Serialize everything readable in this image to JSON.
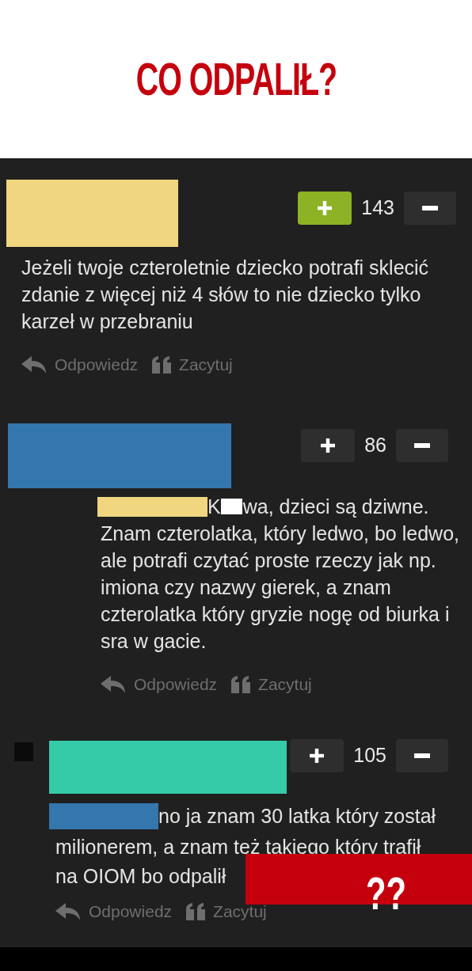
{
  "headline": "CO ODPALIŁ?",
  "comments": [
    {
      "color": "#f0d67f",
      "votes": {
        "upvoted": true,
        "score": "143"
      },
      "text": "Jeżeli twoje czteroletnie dziecko potrafi sklecić zdanie z więcej niż 4 słów to nie dziecko tylko karzeł w przebraniu",
      "actions": [
        "Odpowiedz",
        "Zacytuj"
      ]
    },
    {
      "color": "#3476ae",
      "votes": {
        "upvoted": false,
        "score": "86"
      },
      "reply_to": {
        "color": "#f0d67f"
      },
      "lead": "K",
      "censor": true,
      "first_line": "wa, dzieci są dziwne.",
      "text": "Znam czterolatka, który ledwo, bo ledwo, ale potrafi czytać proste rzeczy jak np. imiona czy nazwy gierek, a znam czterolatka który gryzie nogę od biurka i sra w gacie.",
      "actions": [
        "Odpowiedz",
        "Zacytuj"
      ]
    },
    {
      "color": "#35cba8",
      "avatar": true,
      "votes": {
        "upvoted": false,
        "score": "105"
      },
      "reply_to": {
        "color": "#3476ae"
      },
      "first_line": "no ja znam 30 latka który został",
      "text": "milionerem, a znam też takiego który trafił",
      "last_line": "na OIOM bo odpalił",
      "actions": [
        "Odpowiedz",
        "Zacytuj"
      ]
    }
  ],
  "overlay": {
    "text": "??"
  }
}
